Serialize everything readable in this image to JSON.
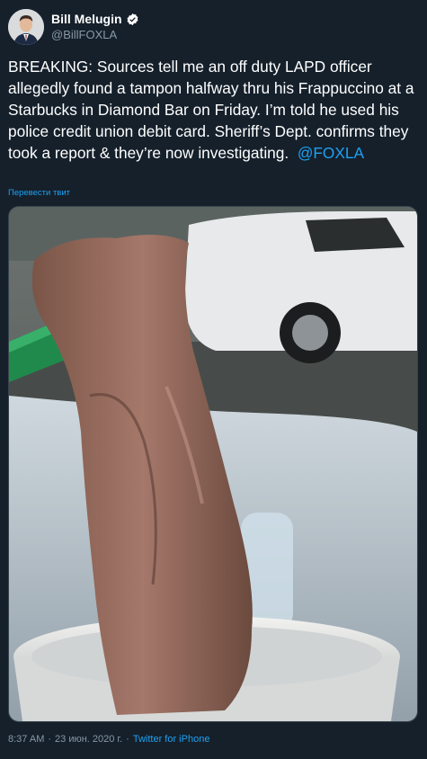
{
  "author": {
    "display_name": "Bill Melugin",
    "handle": "@BillFOXLA",
    "verified_icon": "verified-badge-icon"
  },
  "tweet": {
    "text_main": "BREAKING: Sources tell me an off duty LAPD officer allegedly found a tampon halfway thru his Frappuccino at a Starbucks in Diamond Bar on Friday. I’m told he used his police credit union debit card. Sheriff’s Dept. confirms they took a report & they’re now investigating.",
    "mention": "@FOXLA",
    "translate_label": "Перевести твит"
  },
  "meta": {
    "time": "8:37 AM",
    "separator": "·",
    "date": "23 июн. 2020 г.",
    "source": "Twitter for iPhone"
  },
  "colors": {
    "background": "#15202b",
    "link": "#1da1f2",
    "secondary_text": "#8899a6"
  }
}
